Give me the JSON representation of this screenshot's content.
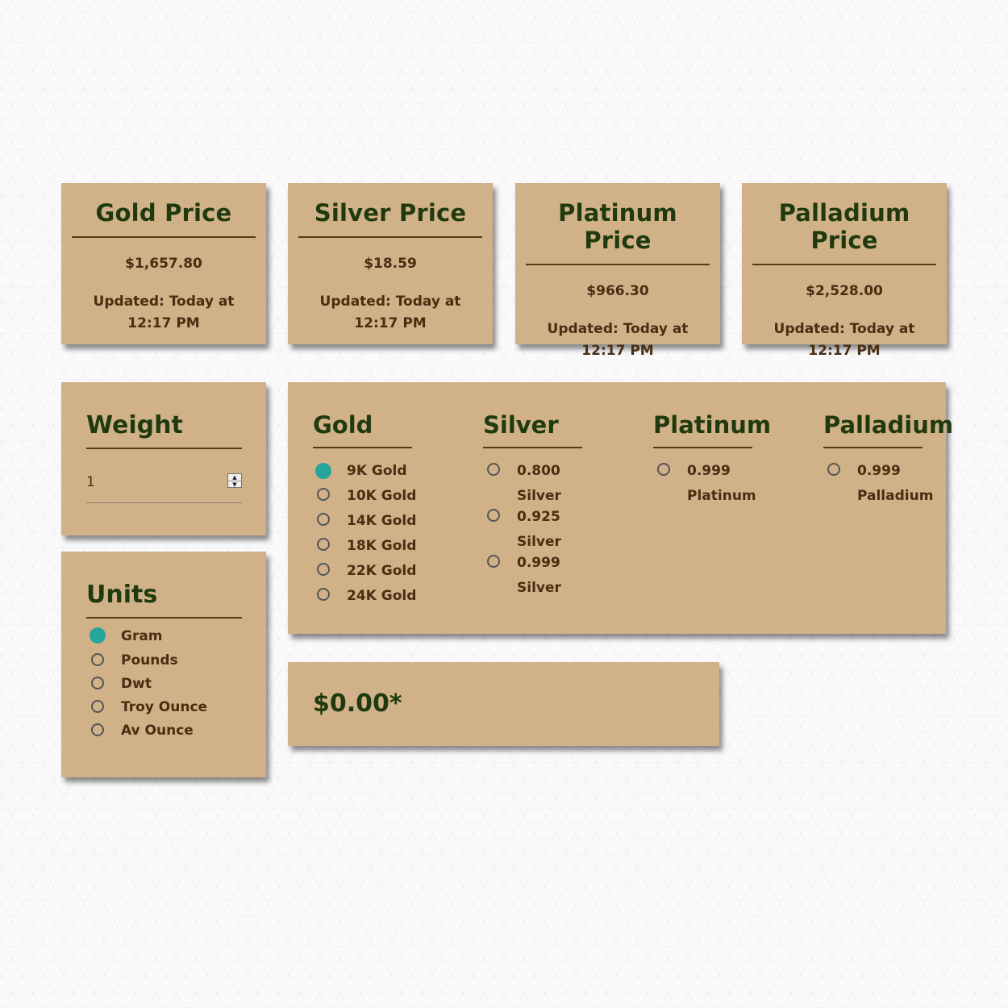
{
  "prices": [
    {
      "title": "Gold Price",
      "value": "$1,657.80",
      "updated": "Updated: Today at 12:17 PM"
    },
    {
      "title": "Silver Price",
      "value": "$18.59",
      "updated": "Updated: Today at 12:17 PM"
    },
    {
      "title": "Platinum Price",
      "value": "$966.30",
      "updated": "Updated: Today at 12:17 PM"
    },
    {
      "title": "Palladium Price",
      "value": "$2,528.00",
      "updated": "Updated: Today at 12:17 PM"
    }
  ],
  "weight": {
    "title": "Weight",
    "value": "1"
  },
  "units": {
    "title": "Units",
    "options": [
      "Gram",
      "Pounds",
      "Dwt",
      "Troy Ounce",
      "Av Ounce"
    ],
    "selected": "Gram"
  },
  "metals": {
    "gold": {
      "title": "Gold",
      "options": [
        "9K Gold",
        "10K Gold",
        "14K Gold",
        "18K Gold",
        "22K Gold",
        "24K Gold"
      ],
      "selected": "9K Gold"
    },
    "silver": {
      "title": "Silver",
      "options": [
        "0.800",
        "Silver",
        "0.925",
        "Silver",
        "0.999",
        "Silver"
      ]
    },
    "platinum": {
      "title": "Platinum",
      "options": [
        "0.999",
        "Platinum"
      ]
    },
    "palladium": {
      "title": "Palladium",
      "options": [
        "0.999",
        "Palladium"
      ]
    }
  },
  "total": "$0.00*",
  "colors": {
    "accent": "#26a69a",
    "card": "#d1b188",
    "heading": "#1f3a0e",
    "text": "#4a2e12"
  }
}
